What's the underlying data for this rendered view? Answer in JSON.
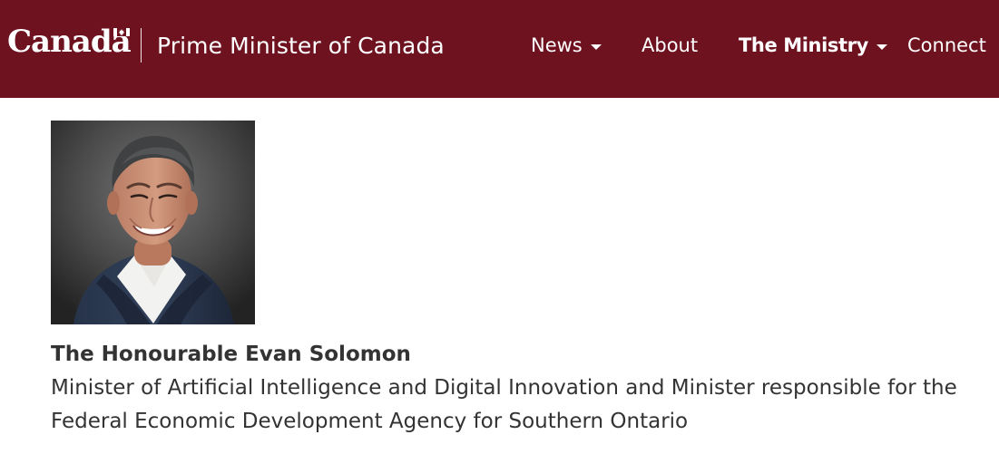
{
  "header": {
    "brand_wordmark": "Canada",
    "site_title": "Prime Minister of Canada",
    "nav": [
      {
        "label": "News",
        "has_dropdown": true,
        "active": false
      },
      {
        "label": "About",
        "has_dropdown": false,
        "active": false
      },
      {
        "label": "The Ministry",
        "has_dropdown": true,
        "active": true
      },
      {
        "label": "Connect",
        "has_dropdown": false,
        "active": false
      }
    ]
  },
  "profile": {
    "name": "The Honourable Evan Solomon",
    "title": "Minister of Artificial Intelligence and Digital Innovation and Minister responsible for the Federal Economic Development Agency for Southern Ontario"
  },
  "colors": {
    "header_background": "#6e1220",
    "text": "#333333",
    "nav_text": "#ffffff"
  },
  "icons": {
    "brand_flag": "canada-flag-icon",
    "dropdown": "caret-down-icon"
  }
}
